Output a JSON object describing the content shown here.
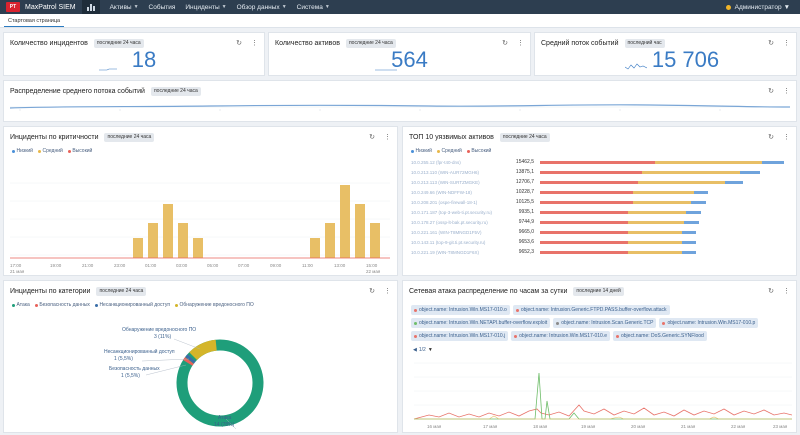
{
  "app": {
    "logo": "PT",
    "brand": "MaxPatrol SIEM",
    "nav": [
      "Активы",
      "События",
      "Инциденты",
      "Обзор данных",
      "Система"
    ],
    "user": "Администратор"
  },
  "tabs": [
    "Стартовая страница"
  ],
  "colors": {
    "low": "#4a90d9",
    "medium": "#e8b84a",
    "high": "#e8625a",
    "accent": "#3a7bc4"
  },
  "kpis": [
    {
      "title": "Количество инцидентов",
      "period": "последние 24 часа",
      "value": "18"
    },
    {
      "title": "Количество активов",
      "period": "последние 24 часа",
      "value": "564"
    },
    {
      "title": "Средний поток событий",
      "period": "последний час",
      "value": "15 706"
    }
  ],
  "flow": {
    "title": "Распределение среднего потока событий",
    "period": "последние 24 часа"
  },
  "incidents_by_severity": {
    "title": "Инциденты по критичности",
    "period": "последние 24 часа",
    "legend": [
      "Низкий",
      "Средний",
      "Высокий"
    ],
    "x_labels": [
      "17:00",
      "19:00",
      "21:00",
      "23:00",
      "01:00",
      "03:00",
      "05:00",
      "07:00",
      "09:00",
      "11:00",
      "13:00",
      "15:00"
    ],
    "x_label_start": "21 мая",
    "x_label_end": "22 мая"
  },
  "top_assets": {
    "title": "ТОП 10 уязвимых активов",
    "period": "последние 24 часа",
    "legend": [
      "Низкий",
      "Средний",
      "Высокий"
    ],
    "rows": [
      {
        "name": "10.0.255.12 (fpr-t40-dns)",
        "value": "15462,5"
      },
      {
        "name": "10.0.213.110 (WIN-AUR72MGH6)",
        "value": "13875,1"
      },
      {
        "name": "10.0.213.113 (WIN-SURTZMGKE)",
        "value": "12706,7"
      },
      {
        "name": "10.0.249.66 (WIN-NDFFW-18)",
        "value": "10228,7"
      },
      {
        "name": "10.0.208.201 (ospe-firewall-18-1)",
        "value": "10125,5"
      },
      {
        "name": "10.0.171.187 (top-3-web-ti.pt.security.ru)",
        "value": "9935,1"
      },
      {
        "name": "10.0.178.27 (ossp-lt-bak.pt.security.ru)",
        "value": "9744,9"
      },
      {
        "name": "10.0.221.161 (WIN-T8MNGD1F5V)",
        "value": "9665,0"
      },
      {
        "name": "10.0.143.11 (top-9-git.ti.pt.security.ru)",
        "value": "9653,6"
      },
      {
        "name": "10.0.221.19 (WIN-T8MNGD1F6X)",
        "value": "9652,3"
      }
    ]
  },
  "incidents_by_category": {
    "title": "Инциденты по категории",
    "period": "последние 24 часа",
    "legend": [
      "Атака",
      "Безопасность данных",
      "Несанкционированный доступ",
      "Обнаружение вредоносного ПО"
    ],
    "labels": [
      {
        "name": "Обнаружение вредоносного ПО",
        "pct": "3 (11%)"
      },
      {
        "name": "Несанкционированный доступ",
        "pct": "1 (5,5%)"
      },
      {
        "name": "Безопасность данных",
        "pct": "1 (5,5%)"
      },
      {
        "name": "Атака",
        "pct": "14 (78%)"
      }
    ]
  },
  "network_attack": {
    "title": "Сетевая атака распределение по часам за сутки",
    "period": "последние 14 дней",
    "filters": [
      "object.name: Intrusion.Win.MS17-010.o",
      "object.name: Intrusion.Generic.FTPD.PASS.buffer-overflow.attack",
      "object.name: Intrusion.Win.NETAPI.buffer-overflow.exploit",
      "object.name: Intrusion.Scan.Generic.TCP",
      "object.name: Intrusion.Win.MS17-010.p",
      "object.name: Intrusion.Win.MS17-010.j",
      "object.name: Intrusion.Win.MS17-010.e",
      "object.name: DoS.Generic.SYNFlood"
    ],
    "page": "1/2",
    "x_labels": [
      "16 мая",
      "17 мая",
      "18 мая",
      "19 мая",
      "20 мая",
      "21 мая",
      "22 мая",
      "23 мая"
    ]
  }
}
